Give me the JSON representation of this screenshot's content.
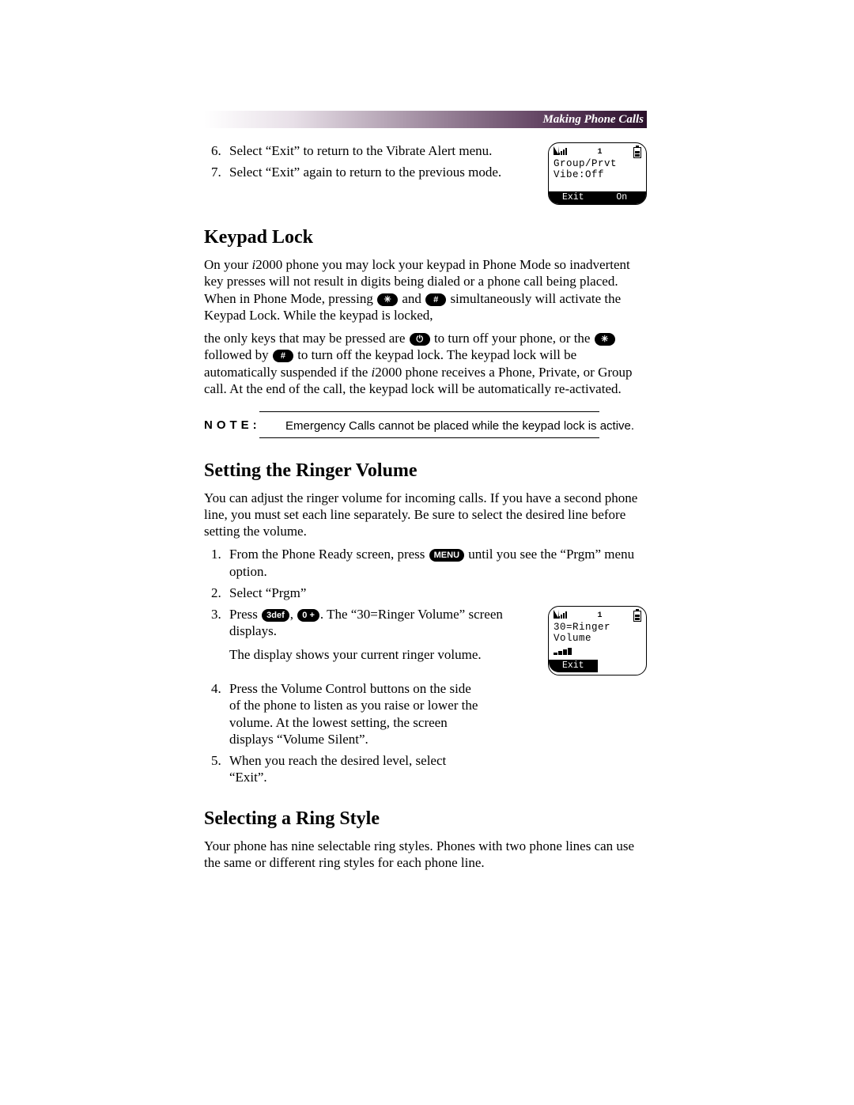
{
  "header": {
    "section_title": "Making Phone Calls"
  },
  "vibrate_steps_start": 6,
  "vibrate_steps": [
    "Select “Exit” to return to the Vibrate Alert menu.",
    "Select “Exit” again to return to the previous mode."
  ],
  "lcd1": {
    "indicator": "1",
    "line1": "Group/Prvt",
    "line2": "Vibe:Off",
    "softkey_left": "Exit",
    "softkey_right": "On"
  },
  "keypad_lock": {
    "heading": "Keypad Lock",
    "p1a": "On your ",
    "p1_model_italic": "i",
    "p1_model_rest": "2000 phone you may lock your keypad in Phone Mode so inadvertent key presses will not result in digits being dialed or a phone call being placed. When in Phone Mode, pressing ",
    "p1_mid": " and ",
    "p1b": " simultaneously will activate the Keypad Lock. While the keypad is locked,",
    "p2a": "the only keys that may be pressed are ",
    "p2b": " to turn off your phone, or the ",
    "p2c": " followed by ",
    "p2d": " to turn off the keypad lock. The keypad lock will be automatically suspended if the ",
    "p2_model_italic": "i",
    "p2_model_rest": "2000 phone receives a Phone, Private, or Group call. At the end of the call, the keypad lock will be automatically re-activated.",
    "key_star": "✳",
    "key_hash": "#",
    "key_power": "⏻",
    "key_menu": "MENU",
    "key_3": "3def",
    "key_0": "0 +"
  },
  "note": {
    "label": "NOTE:",
    "text": "Emergency Calls cannot be placed while the keypad lock is active."
  },
  "ringer": {
    "heading": "Setting the Ringer Volume",
    "intro": "You can adjust the ringer volume for incoming calls. If you have a second phone line, you must set each line separately. Be sure to select the desired line before setting the volume.",
    "step1a": "From the Phone Ready screen, press ",
    "step1b": " until you see the “Prgm” menu option.",
    "step2": "Select “Prgm”",
    "step3a": "Press ",
    "step3_mid": ", ",
    "step3b": ". The “30=Ringer Volume” screen displays.",
    "step3_tail": "The display shows your current ringer volume.",
    "step4": "Press the Volume Control buttons on the side of the phone to listen as you raise or lower the volume. At the lowest setting, the screen displays “Volume Silent”.",
    "step5": "When you reach the desired level, select “Exit”."
  },
  "lcd2": {
    "indicator": "1",
    "line1": "30=Ringer",
    "line2": "Volume",
    "softkey_left": "Exit"
  },
  "ringstyle": {
    "heading": "Selecting a Ring Style",
    "intro": "Your phone has nine selectable ring styles. Phones with two phone lines can use the same or different ring styles for each phone line."
  }
}
